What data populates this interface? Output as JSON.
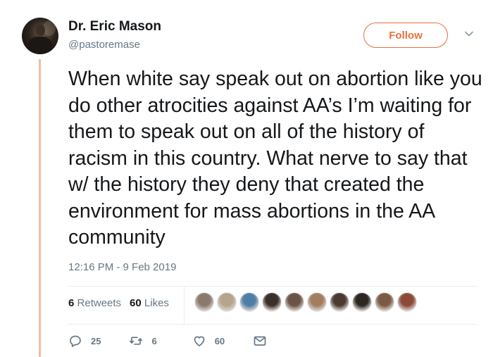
{
  "author": {
    "name": "Dr. Eric Mason",
    "handle": "@pastoremase"
  },
  "follow_label": "Follow",
  "tweet": {
    "text": "When white say speak out on abortion like you do other atrocities against AA’s I’m waiting for them to speak out on all of the history of racism in this country. What nerve to say that w/ the history they deny that created the environment for mass abortions in the AA community",
    "timestamp": "12:16 PM - 9 Feb 2019"
  },
  "stats": {
    "retweets_count": "6",
    "retweets_label": "Retweets",
    "likes_count": "60",
    "likes_label": "Likes"
  },
  "actions": {
    "replies": "25",
    "retweets": "6",
    "likes": "60"
  },
  "liker_avatars": [
    "#8a7a6c",
    "#b7a48c",
    "#4d7fa6",
    "#3b2f2a",
    "#6b5445",
    "#a27d5e",
    "#4a3a32",
    "#2c2520",
    "#7a5a44",
    "#8b4a36"
  ],
  "colors": {
    "accent": "#e8703e",
    "thread_line": "#f7b9a3",
    "secondary_text": "#657786"
  },
  "icons": [
    "reply-icon",
    "retweet-icon",
    "heart-icon",
    "direct-message-icon",
    "chevron-down-icon"
  ]
}
